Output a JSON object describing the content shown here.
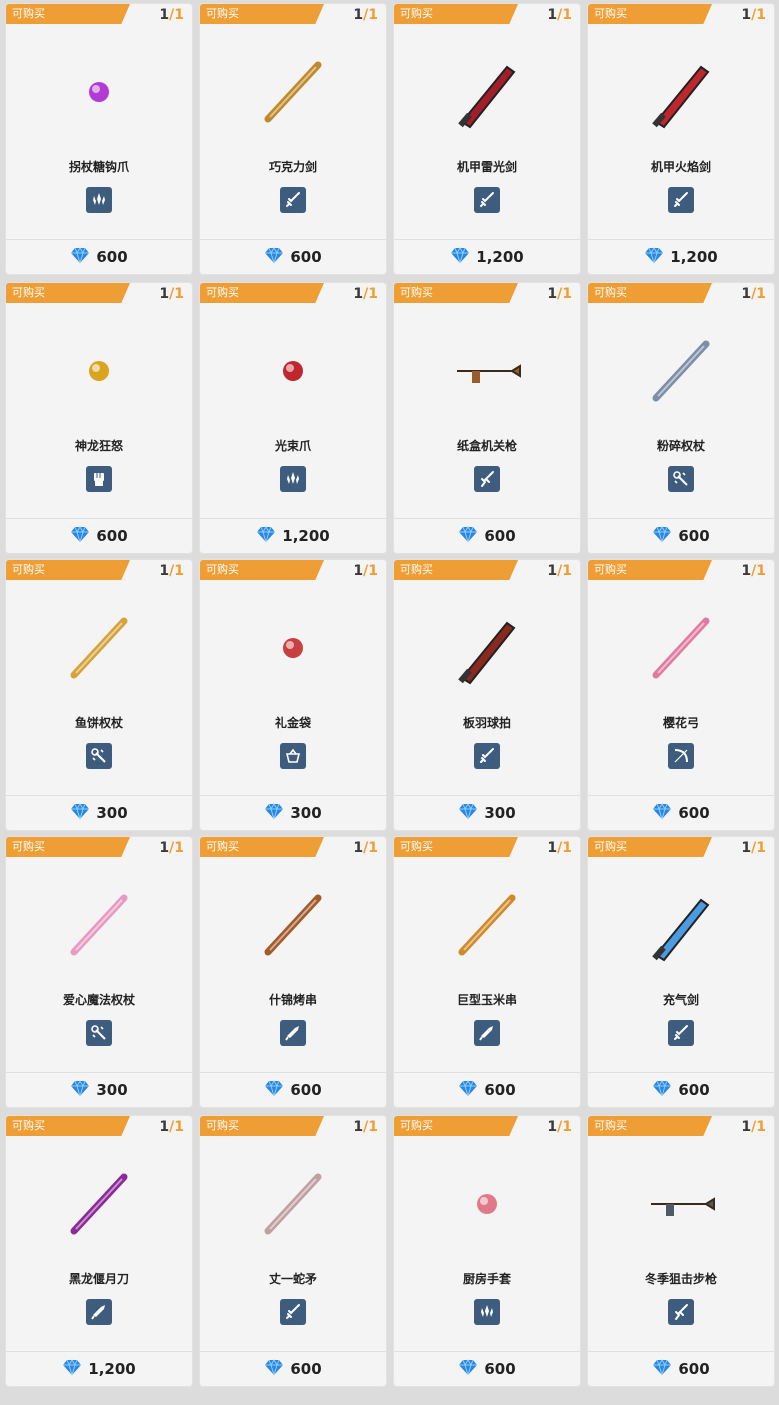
{
  "buy_tag": "可购买",
  "items": [
    {
      "name": "拐杖糖钩爪",
      "count": "1",
      "total": "1",
      "price": "600",
      "type": "claw-icon"
    },
    {
      "name": "巧克力剑",
      "count": "1",
      "total": "1",
      "price": "600",
      "type": "sword-icon"
    },
    {
      "name": "机甲雷光剑",
      "count": "1",
      "total": "1",
      "price": "1,200",
      "type": "sword-icon"
    },
    {
      "name": "机甲火焰剑",
      "count": "1",
      "total": "1",
      "price": "1,200",
      "type": "sword-icon"
    },
    {
      "name": "神龙狂怒",
      "count": "1",
      "total": "1",
      "price": "600",
      "type": "fist-icon"
    },
    {
      "name": "光束爪",
      "count": "1",
      "total": "1",
      "price": "1,200",
      "type": "claw-icon"
    },
    {
      "name": "纸盒机关枪",
      "count": "1",
      "total": "1",
      "price": "600",
      "type": "gun-icon"
    },
    {
      "name": "粉碎权杖",
      "count": "1",
      "total": "1",
      "price": "600",
      "type": "staff-icon"
    },
    {
      "name": "鱼饼权杖",
      "count": "1",
      "total": "1",
      "price": "300",
      "type": "staff-icon"
    },
    {
      "name": "礼金袋",
      "count": "1",
      "total": "1",
      "price": "300",
      "type": "basket-icon"
    },
    {
      "name": "板羽球拍",
      "count": "1",
      "total": "1",
      "price": "300",
      "type": "sword-icon"
    },
    {
      "name": "樱花弓",
      "count": "1",
      "total": "1",
      "price": "600",
      "type": "bow-icon"
    },
    {
      "name": "爱心魔法权杖",
      "count": "1",
      "total": "1",
      "price": "300",
      "type": "staff-icon"
    },
    {
      "name": "什锦烤串",
      "count": "1",
      "total": "1",
      "price": "600",
      "type": "blade-icon"
    },
    {
      "name": "巨型玉米串",
      "count": "1",
      "total": "1",
      "price": "600",
      "type": "blade-icon"
    },
    {
      "name": "充气剑",
      "count": "1",
      "total": "1",
      "price": "600",
      "type": "sword-icon"
    },
    {
      "name": "黑龙偃月刀",
      "count": "1",
      "total": "1",
      "price": "1,200",
      "type": "blade-icon"
    },
    {
      "name": "丈一蛇矛",
      "count": "1",
      "total": "1",
      "price": "600",
      "type": "sword-icon"
    },
    {
      "name": "厨房手套",
      "count": "1",
      "total": "1",
      "price": "600",
      "type": "claw-icon"
    },
    {
      "name": "冬季狙击步枪",
      "count": "1",
      "total": "1",
      "price": "600",
      "type": "gun-icon"
    }
  ],
  "colors": {
    "tag": "#ee9e35",
    "badge": "#3e5d7e",
    "gem": "#2a86e0",
    "card": "#f4f4f4"
  }
}
